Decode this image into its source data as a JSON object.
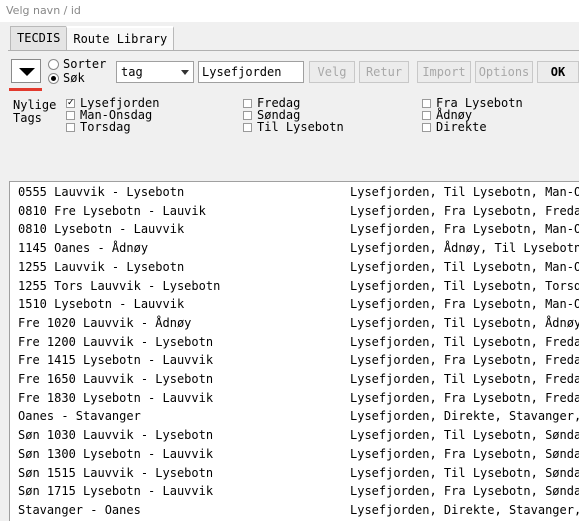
{
  "window": {
    "title": "Velg navn / id"
  },
  "tabs": [
    {
      "label": "TECDIS",
      "active": false
    },
    {
      "label": "Route Library",
      "active": true
    }
  ],
  "toolbar": {
    "radio_sort": "Sorter",
    "radio_search": "Søk",
    "selected_radio": "search",
    "field_select": "tag",
    "search_value": "Lysefjorden",
    "buttons": {
      "select": "Velg",
      "back": "Retur",
      "import": "Import",
      "options": "Options",
      "ok": "OK"
    }
  },
  "tags": {
    "label_line1": "Nylige",
    "label_line2": "Tags",
    "items": [
      {
        "label": "Lysefjorden",
        "checked": true
      },
      {
        "label": "Man-Onsdag",
        "checked": false
      },
      {
        "label": "Torsdag",
        "checked": false
      },
      {
        "label": "Fredag",
        "checked": false
      },
      {
        "label": "Søndag",
        "checked": false
      },
      {
        "label": "Til Lysebotn",
        "checked": false
      },
      {
        "label": "Fra Lysebotn",
        "checked": false
      },
      {
        "label": "Ådnøy",
        "checked": false
      },
      {
        "label": "Direkte",
        "checked": false
      }
    ]
  },
  "routes": [
    {
      "name": "0555 Lauvvik - Lysebotn",
      "tags": "Lysefjorden, Til Lysebotn, Man-Onsda..."
    },
    {
      "name": "0810 Fre Lysebotn - Lauvik",
      "tags": "Lysefjorden, Fra Lysebotn, Fredag, R..."
    },
    {
      "name": "0810 Lysebotn - Lauvvik",
      "tags": "Lysefjorden, Fra Lysebotn, Man-Onsd..."
    },
    {
      "name": "1145 Oanes - Ådnøy",
      "tags": "Lysefjorden, Ådnøy, Til Lysebotn, Ma..."
    },
    {
      "name": "1255 Lauvvik - Lysebotn",
      "tags": "Lysefjorden, Til Lysebotn, Man-Onsda..."
    },
    {
      "name": "1255 Tors Lauvvik - Lysebotn",
      "tags": "Lysefjorden, Til Lysebotn, Torsdag, R..."
    },
    {
      "name": "1510 Lysebotn - Lauvvik",
      "tags": "Lysefjorden, Fra Lysebotn, Man-Onsd..."
    },
    {
      "name": "Fre 1020 Lauvvik - Ådnøy",
      "tags": "Lysefjorden, Til Lysebotn, Ådnøy, Fre..."
    },
    {
      "name": "Fre 1200 Lauvvik - Lysebotn",
      "tags": "Lysefjorden, Til Lysebotn, Fredag, Ru..."
    },
    {
      "name": "Fre 1415 Lysebotn - Lauvvik",
      "tags": "Lysefjorden, Fra Lysebotn, Fredag, R..."
    },
    {
      "name": "Fre 1650 Lauvvik - Lysebotn",
      "tags": "Lysefjorden, Til Lysebotn, Fredag, Ru..."
    },
    {
      "name": "Fre 1830 Lysebotn - Lauvvik",
      "tags": "Lysefjorden, Fra Lysebotn, Fredag, R..."
    },
    {
      "name": "Oanes - Stavanger",
      "tags": "Lysefjorden, Direkte, Stavanger, Ro..."
    },
    {
      "name": "Søn 1030 Lauvvik - Lysebotn",
      "tags": "Lysefjorden, Til Lysebotn, Søndag, Ru..."
    },
    {
      "name": "Søn 1300 Lysebotn - Lauvvik",
      "tags": "Lysefjorden, Fra Lysebotn, Søndag, R..."
    },
    {
      "name": "Søn 1515 Lauvvik - Lysebotn",
      "tags": "Lysefjorden, Til Lysebotn, Søndag, Ru..."
    },
    {
      "name": "Søn 1715 Lysebotn - Lauvvik",
      "tags": "Lysefjorden, Fra Lysebotn, Søndag, R..."
    },
    {
      "name": "Stavanger - Oanes",
      "tags": "Lysefjorden, Direkte, Stavanger, Ro..."
    }
  ],
  "colors": {
    "accent_underline": "#e23a2e"
  }
}
